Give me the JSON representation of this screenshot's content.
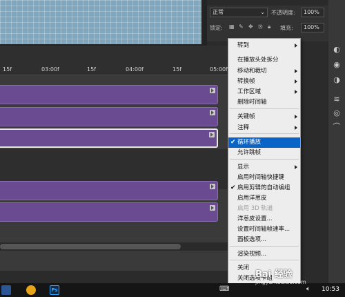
{
  "layers": {
    "blend_mode": "正常",
    "opacity_label": "不透明度:",
    "opacity_value": "100%",
    "lock_label": "锁定:",
    "fill_label": "填充:",
    "fill_value": "100%"
  },
  "ruler": {
    "ticks": [
      "15f",
      "03:00f",
      "15f",
      "04:00f",
      "15f",
      "05:00f"
    ]
  },
  "context_menu": {
    "items": [
      {
        "label": "转到",
        "submenu": true
      },
      {
        "label": "在播放头处拆分"
      },
      {
        "label": "移动和裁切",
        "submenu": true
      },
      {
        "label": "转换帧",
        "submenu": true
      },
      {
        "label": "工作区域",
        "submenu": true
      },
      {
        "label": "删除时间轴"
      },
      {
        "label": "关键帧",
        "submenu": true
      },
      {
        "label": "注释",
        "submenu": true
      },
      {
        "label": "循环播放",
        "checked": true,
        "highlighted": true
      },
      {
        "label": "允许跳帧"
      },
      {
        "label": "显示",
        "submenu": true
      },
      {
        "label": "启用时间轴快捷键"
      },
      {
        "label": "启用剪辑的自动编组",
        "checked": true
      },
      {
        "label": "启用洋葱皮"
      },
      {
        "label": "启用 3D 轨道",
        "disabled": true
      },
      {
        "label": "洋葱皮设置..."
      },
      {
        "label": "设置时间轴帧速率..."
      },
      {
        "label": "面板选项..."
      },
      {
        "label": "渲染视频..."
      },
      {
        "label": "关闭"
      },
      {
        "label": "关闭选项卡组"
      }
    ]
  },
  "taskbar": {
    "ps_label": "Ps",
    "clock": "10:53"
  },
  "watermark": {
    "text": "Bai 经验",
    "url": "jingyan.baidu.com"
  },
  "colors": {
    "clip": "#6a4b92",
    "menu_highlight": "#0a64c8",
    "canvas": "#7fa7bd"
  }
}
